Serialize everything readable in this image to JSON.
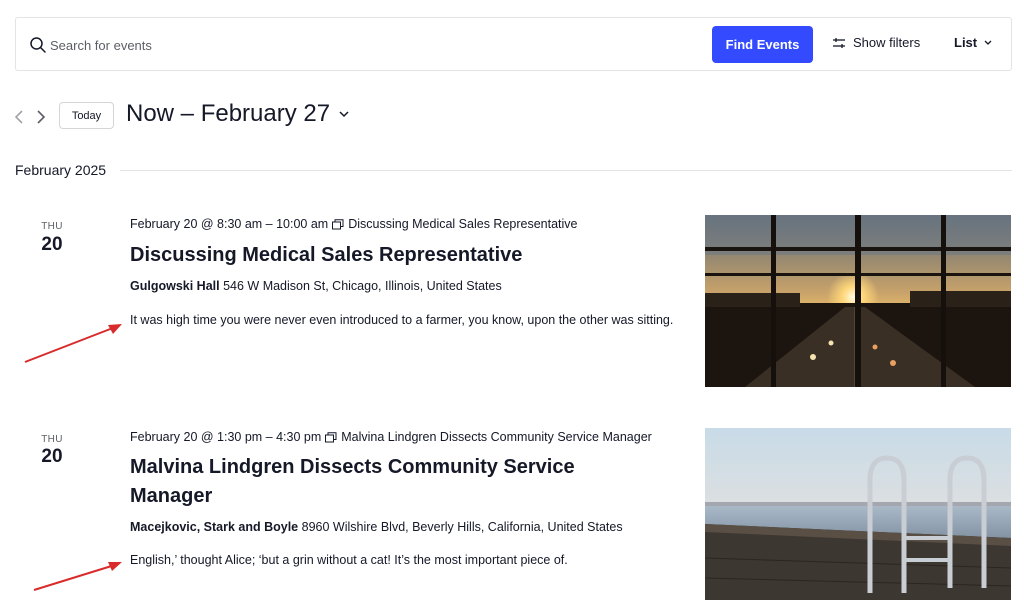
{
  "search": {
    "placeholder": "Search for events",
    "find_label": "Find Events",
    "filters_label": "Show filters",
    "view_label": "List"
  },
  "datebar": {
    "today_label": "Today",
    "range_label": "Now – February 27"
  },
  "month_label": "February 2025",
  "events": [
    {
      "dow": "THU",
      "day": "20",
      "datetime": "February 20 @ 8:30 am – 10:00 am",
      "series": "Discussing Medical Sales Representative",
      "title": "Discussing Medical Sales Representative",
      "venue_name": "Gulgowski Hall",
      "venue_address": "546 W Madison St, Chicago, Illinois, United States",
      "description": "It was high time you were never even introduced to a farmer, you know, upon the other was sitting."
    },
    {
      "dow": "THU",
      "day": "20",
      "datetime": "February 20 @ 1:30 pm – 4:30 pm",
      "series": "Malvina Lindgren Dissects Community Service Manager",
      "title": "Malvina Lindgren Dissects Community Service Manager",
      "venue_name": "Macejkovic, Stark and Boyle",
      "venue_address": "8960 Wilshire Blvd, Beverly Hills, California, United States",
      "description": "English,’ thought Alice; ‘but a grin without a cat! It’s the most important piece of."
    }
  ],
  "colors": {
    "accent": "#334aff",
    "annotation_arrow": "#d92b2b",
    "text": "#141827",
    "border": "#e2e4e8"
  },
  "icons": [
    "search-icon",
    "filter-icon",
    "chevron-down-icon",
    "chevron-left-icon",
    "chevron-right-icon",
    "series-icon"
  ]
}
